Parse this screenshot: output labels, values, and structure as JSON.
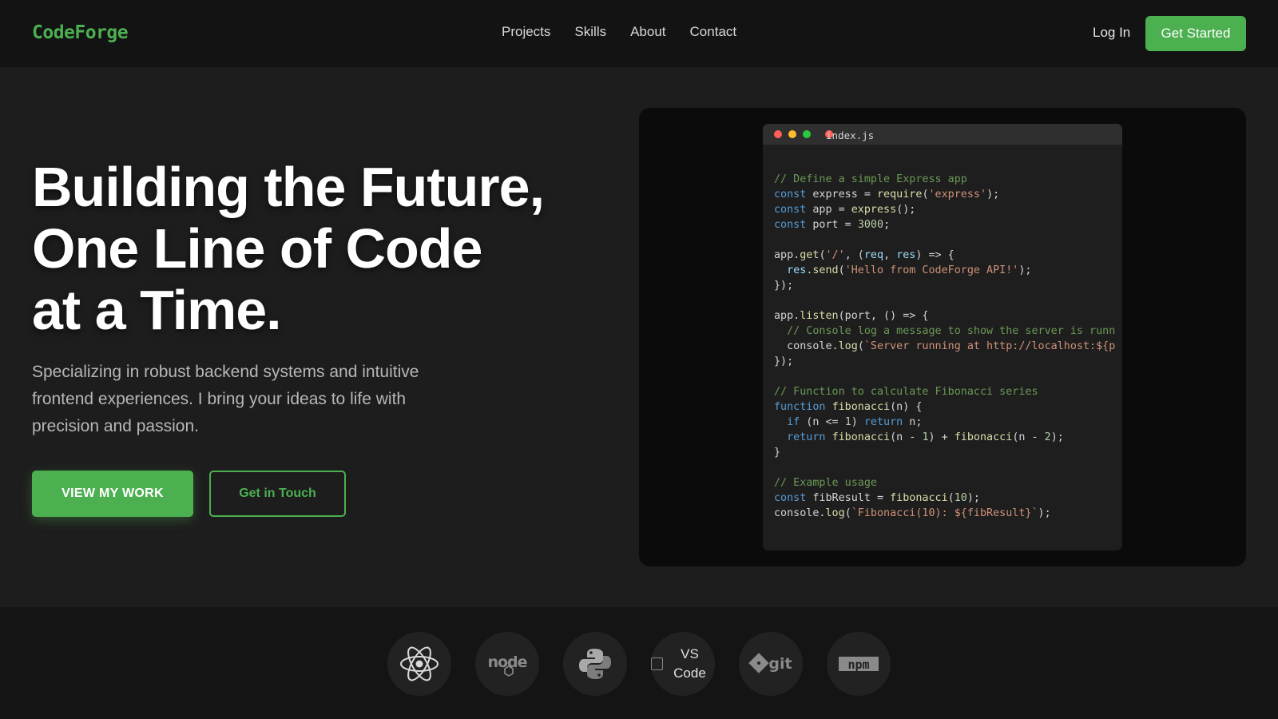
{
  "nav": {
    "logo": "CodeForge",
    "links": [
      "Projects",
      "Skills",
      "About",
      "Contact"
    ],
    "login": "Log In",
    "cta": "Get Started"
  },
  "hero": {
    "title_lines": [
      "Building the Future,",
      "One Line of Code",
      "at a Time."
    ],
    "subtitle": "Specializing in robust backend systems and intuitive frontend experiences. I bring your ideas to life with precision and passion.",
    "primary_button": "VIEW MY WORK",
    "secondary_button": "Get in Touch"
  },
  "editor": {
    "filename": "index.js",
    "lines": [
      "// Define a simple Express app",
      "const express = require('express');",
      "const app = express();",
      "const port = 3000;",
      "",
      "app.get('/', (req, res) => {",
      "  res.send('Hello from CodeForge API!');",
      "});",
      "",
      "app.listen(port, () => {",
      "  // Console log a message to show the server is runn",
      "  console.log(`Server running at http://localhost:${p",
      "});",
      "",
      "// Function to calculate Fibonacci series",
      "function fibonacci(n) {",
      "  if (n <= 1) return n;",
      "  return fibonacci(n - 1) + fibonacci(n - 2);",
      "}",
      "",
      "// Example usage",
      "const fibResult = fibonacci(10);",
      "console.log(`Fibonacci(10): ${fibResult}`);"
    ]
  },
  "tech": {
    "icons": [
      "react-icon",
      "nodejs-icon",
      "python-icon",
      "vscode-icon",
      "git-icon",
      "npm-icon"
    ],
    "vscode_label": "VS Code",
    "node_text": "node",
    "git_text": "git",
    "npm_text": "npm"
  },
  "colors": {
    "accent": "#4caf50",
    "background": "#1d1d1d",
    "nav_background": "#131313"
  }
}
